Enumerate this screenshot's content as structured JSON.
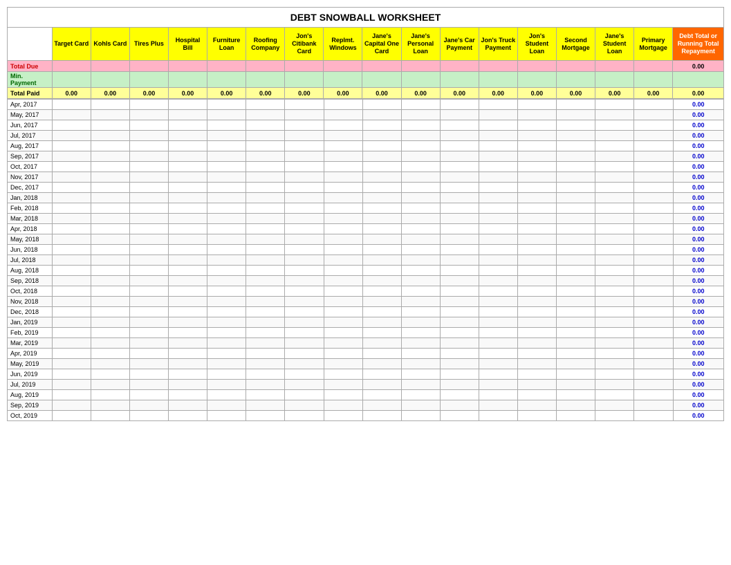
{
  "title": "DEBT SNOWBALL WORKSHEET",
  "columns": [
    {
      "id": "date",
      "label": ""
    },
    {
      "id": "target_card",
      "label": "Target Card"
    },
    {
      "id": "kohls_card",
      "label": "Kohls Card"
    },
    {
      "id": "tires_plus",
      "label": "Tires Plus"
    },
    {
      "id": "hospital_bill",
      "label": "Hospital Bill"
    },
    {
      "id": "furniture_loan",
      "label": "Furniture Loan"
    },
    {
      "id": "roofing_company",
      "label": "Roofing Company"
    },
    {
      "id": "jons_citibank",
      "label": "Jon's Citibank Card"
    },
    {
      "id": "replmt_windows",
      "label": "Replmt. Windows"
    },
    {
      "id": "janes_capital_one",
      "label": "Jane's Capital One Card"
    },
    {
      "id": "janes_personal_loan",
      "label": "Jane's Personal Loan"
    },
    {
      "id": "janes_car_payment",
      "label": "Jane's Car Payment"
    },
    {
      "id": "jons_truck_payment",
      "label": "Jon's Truck Payment"
    },
    {
      "id": "jons_student_loan",
      "label": "Jon's Student Loan"
    },
    {
      "id": "second_mortgage",
      "label": "Second Mortgage"
    },
    {
      "id": "janes_student_loan",
      "label": "Jane's Student Loan"
    },
    {
      "id": "primary_mortgage",
      "label": "Primary Mortgage"
    },
    {
      "id": "debt_total",
      "label": "Debt Total or Running Total Repayment"
    }
  ],
  "rows": {
    "total_due_label": "Total Due",
    "min_payment_label": "Min. Payment",
    "total_paid_label": "Total Paid",
    "zero_value": "0.00",
    "last_col_zero": "0.00"
  },
  "data_rows": [
    "Apr, 2017",
    "May, 2017",
    "Jun, 2017",
    "Jul, 2017",
    "Aug, 2017",
    "Sep, 2017",
    "Oct, 2017",
    "Nov, 2017",
    "Dec, 2017",
    "Jan, 2018",
    "Feb, 2018",
    "Mar, 2018",
    "Apr, 2018",
    "May, 2018",
    "Jun, 2018",
    "Jul, 2018",
    "Aug, 2018",
    "Sep, 2018",
    "Oct, 2018",
    "Nov, 2018",
    "Dec, 2018",
    "Jan, 2019",
    "Feb, 2019",
    "Mar, 2019",
    "Apr, 2019",
    "May, 2019",
    "Jun, 2019",
    "Jul, 2019",
    "Aug, 2019",
    "Sep, 2019",
    "Oct, 2019"
  ]
}
